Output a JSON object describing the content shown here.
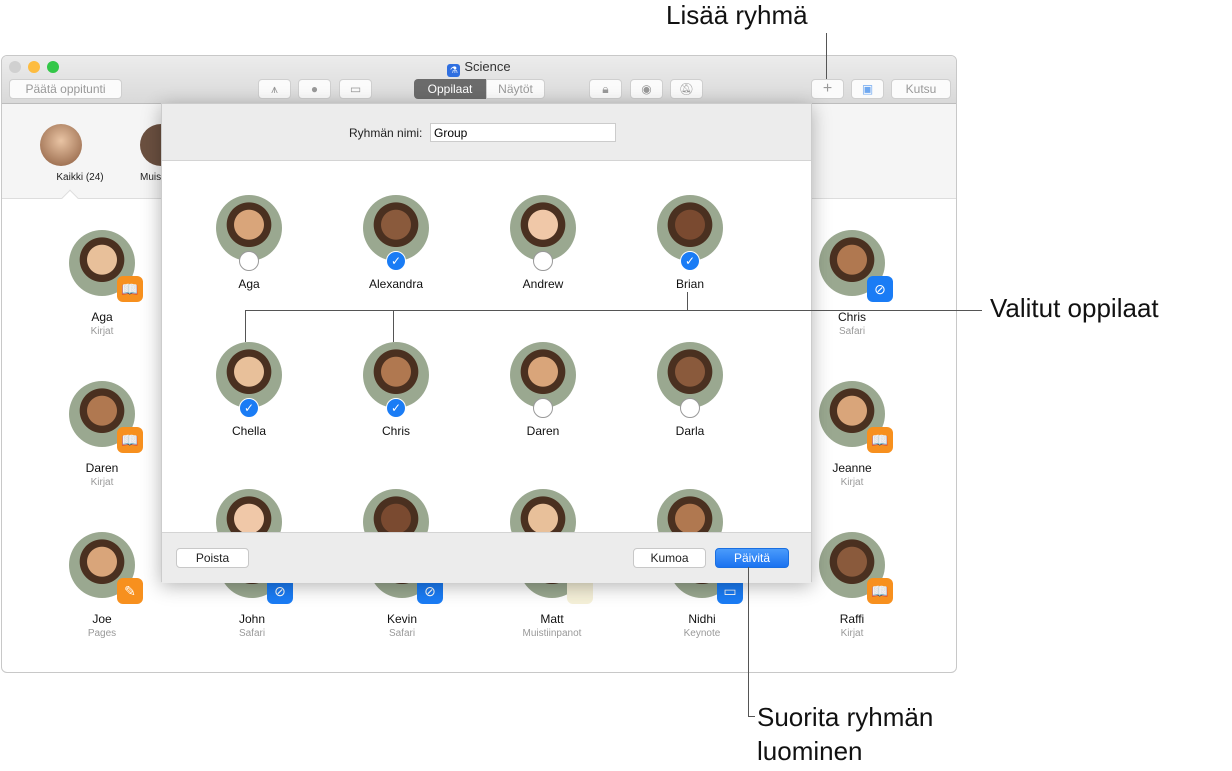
{
  "window": {
    "title": "Science"
  },
  "toolbar": {
    "end_lesson": "Päätä oppitunti",
    "seg_students": "Oppilaat",
    "seg_screens": "Näytöt",
    "invite": "Kutsu",
    "icons": [
      "app-store-icon",
      "safari-icon",
      "airplay-icon",
      "lock-icon",
      "hide-icon",
      "mute-icon",
      "add-icon",
      "handout-icon"
    ]
  },
  "groups": [
    {
      "label": "Kaikki (24)"
    },
    {
      "label": "Muis"
    }
  ],
  "students": [
    {
      "name": "Aga",
      "app": "Kirjat",
      "badge": "#f7901e",
      "glyph": "📖",
      "col": 0,
      "row": 0
    },
    {
      "name": "Daren",
      "app": "Kirjat",
      "badge": "#f7901e",
      "glyph": "📖",
      "col": 0,
      "row": 1
    },
    {
      "name": "Joe",
      "app": "Pages",
      "badge": "#f7901e",
      "glyph": "✎",
      "col": 0,
      "row": 2
    },
    {
      "name": "John",
      "app": "Safari",
      "badge": "#1a7cf5",
      "glyph": "⊘",
      "col": 1,
      "row": 2
    },
    {
      "name": "Kevin",
      "app": "Safari",
      "badge": "#1a7cf5",
      "glyph": "⊘",
      "col": 2,
      "row": 2
    },
    {
      "name": "Matt",
      "app": "Muistiinpanot",
      "badge": "#f5f0d8",
      "glyph": "",
      "col": 3,
      "row": 2
    },
    {
      "name": "Nidhi",
      "app": "Keynote",
      "badge": "#1a7cf5",
      "glyph": "▭",
      "col": 4,
      "row": 2
    },
    {
      "name": "Chris",
      "app": "Safari",
      "badge": "#1a7cf5",
      "glyph": "⊘",
      "col": 5,
      "row": 0
    },
    {
      "name": "Jeanne",
      "app": "Kirjat",
      "badge": "#f7901e",
      "glyph": "📖",
      "col": 5,
      "row": 1
    },
    {
      "name": "Raffi",
      "app": "Kirjat",
      "badge": "#f7901e",
      "glyph": "📖",
      "col": 5,
      "row": 2
    }
  ],
  "dialog": {
    "name_label": "Ryhmän nimi:",
    "name_value": "Group",
    "delete": "Poista",
    "cancel": "Kumoa",
    "update": "Päivitä",
    "members": [
      {
        "name": "Aga",
        "selected": false
      },
      {
        "name": "Alexandra",
        "selected": true
      },
      {
        "name": "Andrew",
        "selected": false
      },
      {
        "name": "Brian",
        "selected": true
      },
      {
        "name": "Chella",
        "selected": true
      },
      {
        "name": "Chris",
        "selected": true
      },
      {
        "name": "Daren",
        "selected": false
      },
      {
        "name": "Darla",
        "selected": false
      },
      {
        "name": "",
        "selected": false
      },
      {
        "name": "",
        "selected": false
      },
      {
        "name": "",
        "selected": false
      },
      {
        "name": "",
        "selected": false
      }
    ]
  },
  "annotations": {
    "add_group": "Lisää ryhmä",
    "selected_students": "Valitut oppilaat",
    "finish_line1": "Suorita ryhmän",
    "finish_line2": "luominen"
  },
  "colors": {
    "accent": "#1a7cf5",
    "books": "#f7901e"
  }
}
